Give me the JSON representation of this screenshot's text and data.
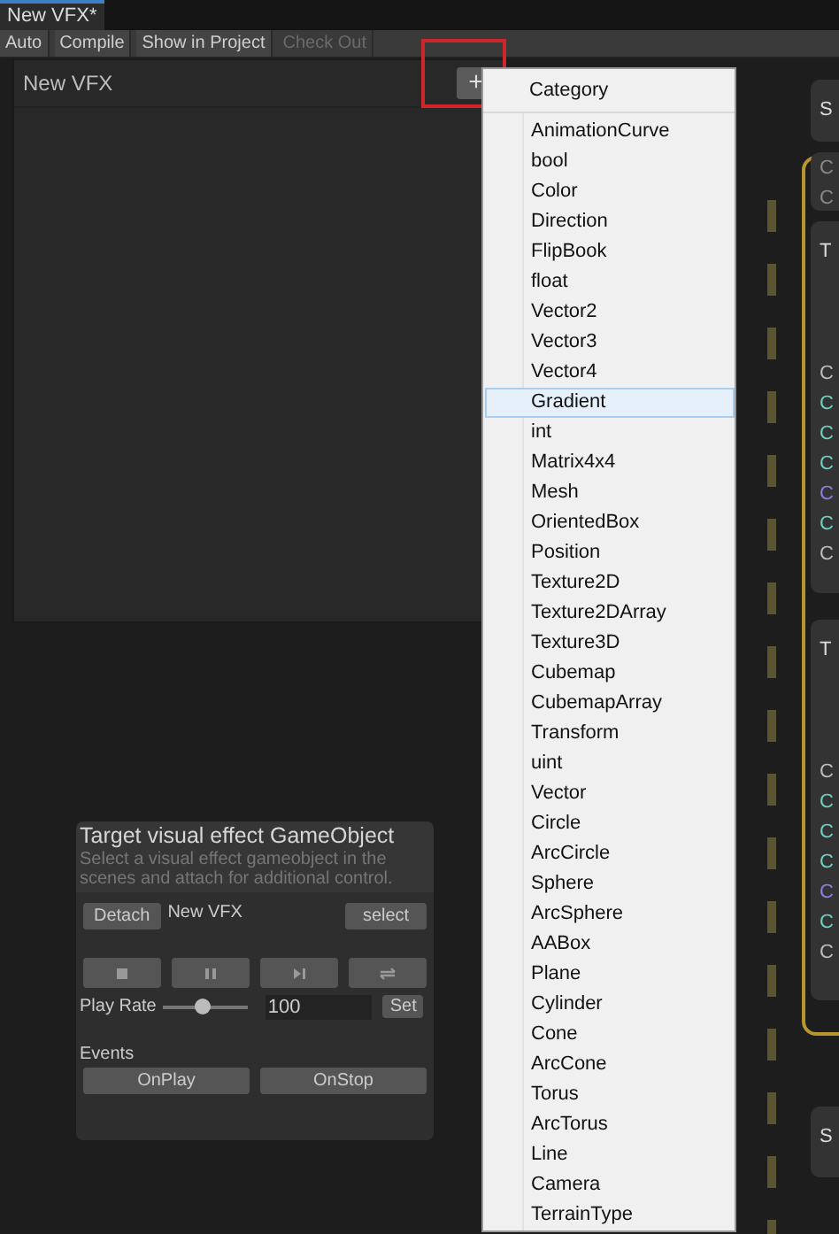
{
  "tabs": [
    {
      "label": "New VFX*",
      "selected": true
    }
  ],
  "toolbar": [
    {
      "label": "Auto",
      "disabled": false
    },
    {
      "label": "Compile",
      "disabled": false
    },
    {
      "label": "Show in Project",
      "disabled": false
    },
    {
      "label": "Check Out",
      "disabled": true
    }
  ],
  "blackboard": {
    "title": "New VFX",
    "add_button": "+"
  },
  "menu": {
    "header": "Category",
    "items": [
      {
        "label": "AnimationCurve",
        "selected": false
      },
      {
        "label": "bool",
        "selected": false
      },
      {
        "label": "Color",
        "selected": false
      },
      {
        "label": "Direction",
        "selected": false
      },
      {
        "label": "FlipBook",
        "selected": false
      },
      {
        "label": "float",
        "selected": false
      },
      {
        "label": "Vector2",
        "selected": false
      },
      {
        "label": "Vector3",
        "selected": false
      },
      {
        "label": "Vector4",
        "selected": false
      },
      {
        "label": "Gradient",
        "selected": true
      },
      {
        "label": "int",
        "selected": false
      },
      {
        "label": "Matrix4x4",
        "selected": false
      },
      {
        "label": "Mesh",
        "selected": false
      },
      {
        "label": "OrientedBox",
        "selected": false
      },
      {
        "label": "Position",
        "selected": false
      },
      {
        "label": "Texture2D",
        "selected": false
      },
      {
        "label": "Texture2DArray",
        "selected": false
      },
      {
        "label": "Texture3D",
        "selected": false
      },
      {
        "label": "Cubemap",
        "selected": false
      },
      {
        "label": "CubemapArray",
        "selected": false
      },
      {
        "label": "Transform",
        "selected": false
      },
      {
        "label": "uint",
        "selected": false
      },
      {
        "label": "Vector",
        "selected": false
      },
      {
        "label": "Circle",
        "selected": false
      },
      {
        "label": "ArcCircle",
        "selected": false
      },
      {
        "label": "Sphere",
        "selected": false
      },
      {
        "label": "ArcSphere",
        "selected": false
      },
      {
        "label": "AABox",
        "selected": false
      },
      {
        "label": "Plane",
        "selected": false
      },
      {
        "label": "Cylinder",
        "selected": false
      },
      {
        "label": "Cone",
        "selected": false
      },
      {
        "label": "ArcCone",
        "selected": false
      },
      {
        "label": "Torus",
        "selected": false
      },
      {
        "label": "ArcTorus",
        "selected": false
      },
      {
        "label": "Line",
        "selected": false
      },
      {
        "label": "Camera",
        "selected": false
      },
      {
        "label": "TerrainType",
        "selected": false
      }
    ]
  },
  "control_panel": {
    "title": "Target visual effect GameObject",
    "description": "Select a visual effect gameobject in the scenes and attach for additional control.",
    "detach_button": "Detach",
    "target": "New VFX",
    "select_button": "select",
    "transport": [
      {
        "kind": "stop"
      },
      {
        "kind": "pause"
      },
      {
        "kind": "step"
      },
      {
        "kind": "loop"
      }
    ],
    "play_rate": {
      "label": "Play Rate",
      "level": 0.47,
      "value": "100",
      "set_button": "Set"
    },
    "events_label": "Events",
    "event_buttons": [
      "OnPlay",
      "OnStop"
    ]
  },
  "graph_nodes": [
    {
      "title": "S"
    },
    {
      "ports": [
        {
          "label": "C",
          "color": "#8a8a8a"
        },
        {
          "label": "C",
          "color": "#8a8a8a"
        }
      ]
    },
    {
      "title": "T",
      "ports": [
        {
          "label": "C",
          "color": "#bdbdbd"
        },
        {
          "label": "C",
          "color": "#6fd0c0"
        },
        {
          "label": "C",
          "color": "#6fd0c0"
        },
        {
          "label": "C",
          "color": "#6fd0c0"
        },
        {
          "label": "C",
          "color": "#8f7fe0"
        },
        {
          "label": "C",
          "color": "#6fd0c0"
        },
        {
          "label": "C",
          "color": "#bdbdbd"
        }
      ]
    },
    {
      "title": "T",
      "ports": [
        {
          "label": "C",
          "color": "#bdbdbd"
        },
        {
          "label": "C",
          "color": "#6fd0c0"
        },
        {
          "label": "C",
          "color": "#6fd0c0"
        },
        {
          "label": "C",
          "color": "#6fd0c0"
        },
        {
          "label": "C",
          "color": "#8f7fe0"
        },
        {
          "label": "C",
          "color": "#6fd0c0"
        },
        {
          "label": "C",
          "color": "#bdbdbd"
        }
      ]
    },
    {
      "title": "S"
    }
  ]
}
